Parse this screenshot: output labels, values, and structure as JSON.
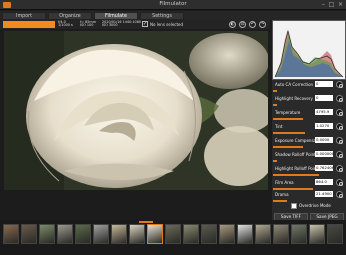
{
  "window": {
    "title": "Filmulator"
  },
  "tabs": [
    {
      "label": "Import",
      "active": false
    },
    {
      "label": "Organize",
      "active": false
    },
    {
      "label": "Filmulate",
      "active": true
    },
    {
      "label": "Settings",
      "active": false
    }
  ],
  "infobar": {
    "filename": "",
    "meta1": [
      "f/4.0",
      "1/1000 s"
    ],
    "meta2": [
      "f= 85mm",
      "ISO 100"
    ],
    "meta3": [
      "2020/01/16 1440:1080",
      "ISO 3000"
    ],
    "lens_checked": true,
    "lens_text": "No lens selected"
  },
  "params": [
    {
      "label": "Auto CA Correction",
      "value": "0"
    },
    {
      "label": "Highlight Recovery",
      "value": "0"
    },
    {
      "label": "Temperature",
      "value": "4795.9"
    },
    {
      "label": "Tint",
      "value": "1.0270"
    },
    {
      "label": "Exposure Compensati...",
      "value": "0.0000"
    },
    {
      "label": "Shadow Rolloff Point",
      "value": "0.000000"
    },
    {
      "label": "Highlight Rolloff Point",
      "value": "0.762406"
    },
    {
      "label": "Film Area",
      "value": "864.0"
    },
    {
      "label": "Drama",
      "value": "21.4900"
    }
  ],
  "overdrive": {
    "label": "Overdrive Mode",
    "checked": false
  },
  "buttons": {
    "save_tiff": "Save TIFF",
    "save_jpeg": "Save JPEG"
  },
  "colors": {
    "accent": "#e07a1a",
    "background": "#1c1c1c"
  },
  "filmstrip": {
    "count": 19,
    "selected_index": 8
  }
}
